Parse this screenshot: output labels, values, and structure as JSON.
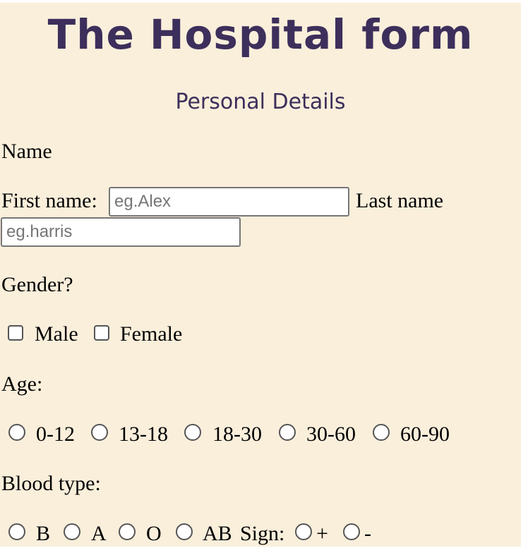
{
  "title": "The Hospital form",
  "subtitle": "Personal Details",
  "name_section": {
    "heading": "Name",
    "first_label": "First name:",
    "first_placeholder": "eg.Alex",
    "last_label": "Last name",
    "last_placeholder": "eg.harris"
  },
  "gender": {
    "question": "Gender?",
    "options": [
      "Male",
      "Female"
    ]
  },
  "age": {
    "question": "Age:",
    "options": [
      "0-12",
      "13-18",
      "18-30",
      "30-60",
      "60-90"
    ]
  },
  "blood": {
    "question": "Blood type:",
    "options": [
      "B",
      "A",
      "O",
      "AB"
    ],
    "sign_label": "Sign:",
    "sign_options": [
      "+",
      "-"
    ]
  },
  "colors": {
    "background": "#faefdb",
    "heading": "#3d2f5b"
  }
}
